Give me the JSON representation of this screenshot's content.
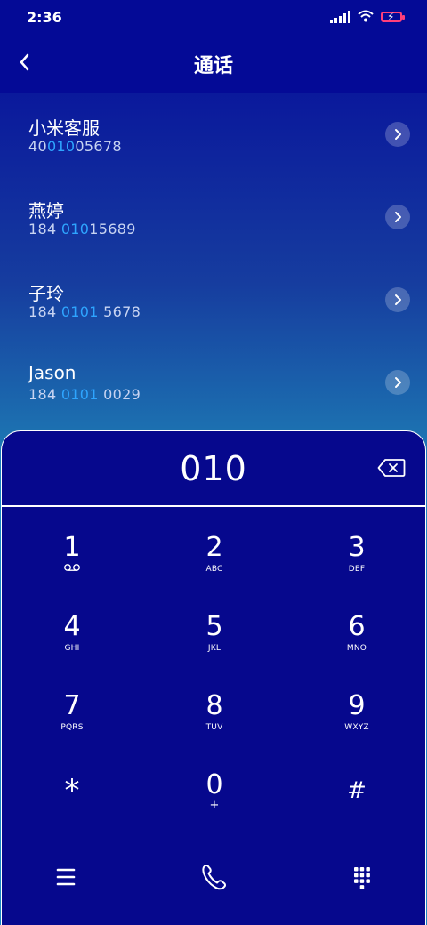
{
  "status": {
    "time": "2:36"
  },
  "header": {
    "title": "通话"
  },
  "contacts": [
    {
      "name": "小米客服",
      "num_pre": "40",
      "num_hl": "010",
      "num_post": "05678"
    },
    {
      "name": "燕婷",
      "num_pre": "184 ",
      "num_hl": "010",
      "num_post": "15689"
    },
    {
      "name": "子玲",
      "num_pre": "184 ",
      "num_hl": "0101",
      "num_post": " 5678"
    },
    {
      "name": "Jason",
      "num_pre": "184 ",
      "num_hl": "0101",
      "num_post": " 0029"
    }
  ],
  "dialpad": {
    "entered": "010",
    "keys": [
      {
        "digit": "1",
        "letters": ""
      },
      {
        "digit": "2",
        "letters": "ABC"
      },
      {
        "digit": "3",
        "letters": "DEF"
      },
      {
        "digit": "4",
        "letters": "GHI"
      },
      {
        "digit": "5",
        "letters": "JKL"
      },
      {
        "digit": "6",
        "letters": "MNO"
      },
      {
        "digit": "7",
        "letters": "PQRS"
      },
      {
        "digit": "8",
        "letters": "TUV"
      },
      {
        "digit": "9",
        "letters": "WXYZ"
      },
      {
        "digit": "*",
        "letters": ""
      },
      {
        "digit": "0",
        "letters": "+"
      },
      {
        "digit": "#",
        "letters": ""
      }
    ]
  },
  "icons": {
    "back": "chevron-left-icon",
    "row_arrow": "chevron-right-icon",
    "backspace": "backspace-icon",
    "voicemail": "voicemail-icon",
    "menu": "menu-icon",
    "call": "phone-icon",
    "keypad": "keypad-icon"
  }
}
